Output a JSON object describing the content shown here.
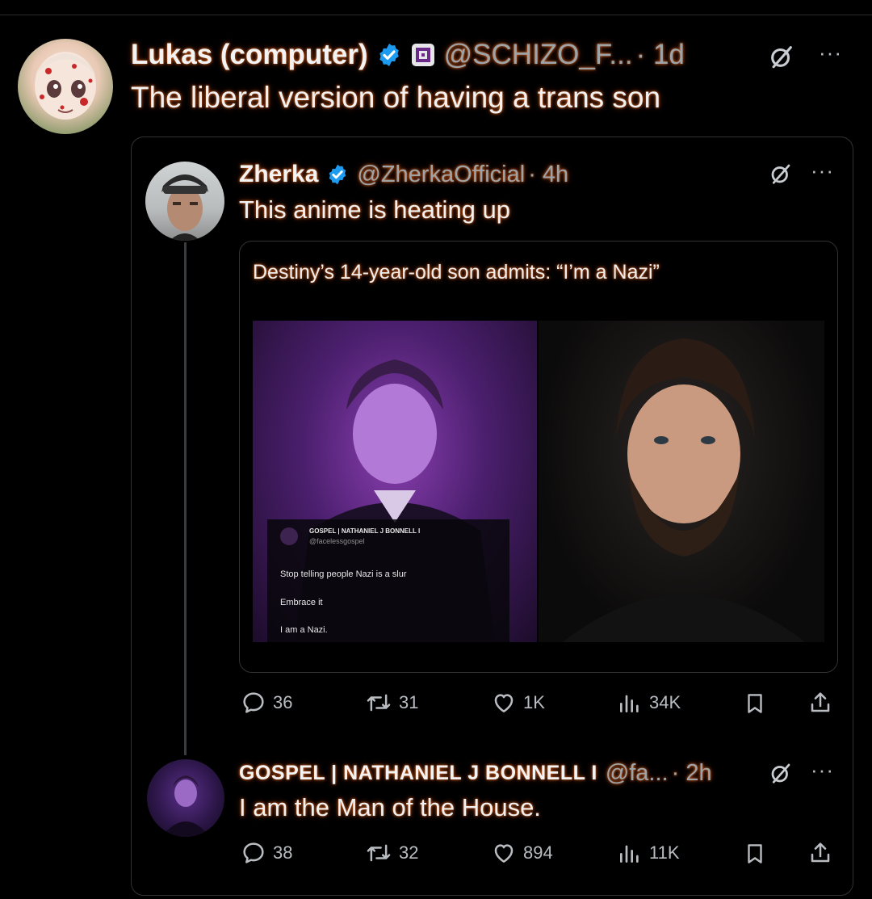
{
  "colors": {
    "background": "#000000",
    "verified": "#1d9bf0",
    "glow": "#ff7a2b",
    "text": "#e7e9ea",
    "muted": "#9ea3a8"
  },
  "main_post": {
    "author_name": "Lukas (computer)",
    "handle": "@SCHIZO_F...",
    "time": "· 1d",
    "text": "The liberal version of having a trans son",
    "avatar_icon": "anime-avatar"
  },
  "quoted_post": {
    "author_name": "Zherka",
    "handle": "@ZherkaOfficial",
    "time": "· 4h",
    "text": "This anime is heating up",
    "embed": {
      "headline": "Destiny’s 14-year-old son admits: “I’m a Nazi”",
      "overlay": {
        "name": "GOSPEL | NATHANIEL J BONNELL I",
        "handle": "@facelessgospel",
        "lines": [
          "Stop telling people Nazi is a slur",
          "Embrace it",
          "I am a Nazi."
        ]
      }
    },
    "metrics": {
      "replies": "36",
      "reposts": "31",
      "likes": "1K",
      "views": "34K"
    }
  },
  "reply_post": {
    "author_name": "GOSPEL | NATHANIEL J BONNELL I",
    "handle": "@fa...",
    "time": "· 2h",
    "text": "I am the Man of the House.",
    "metrics": {
      "replies": "38",
      "reposts": "32",
      "likes": "894",
      "views": "11K"
    }
  }
}
